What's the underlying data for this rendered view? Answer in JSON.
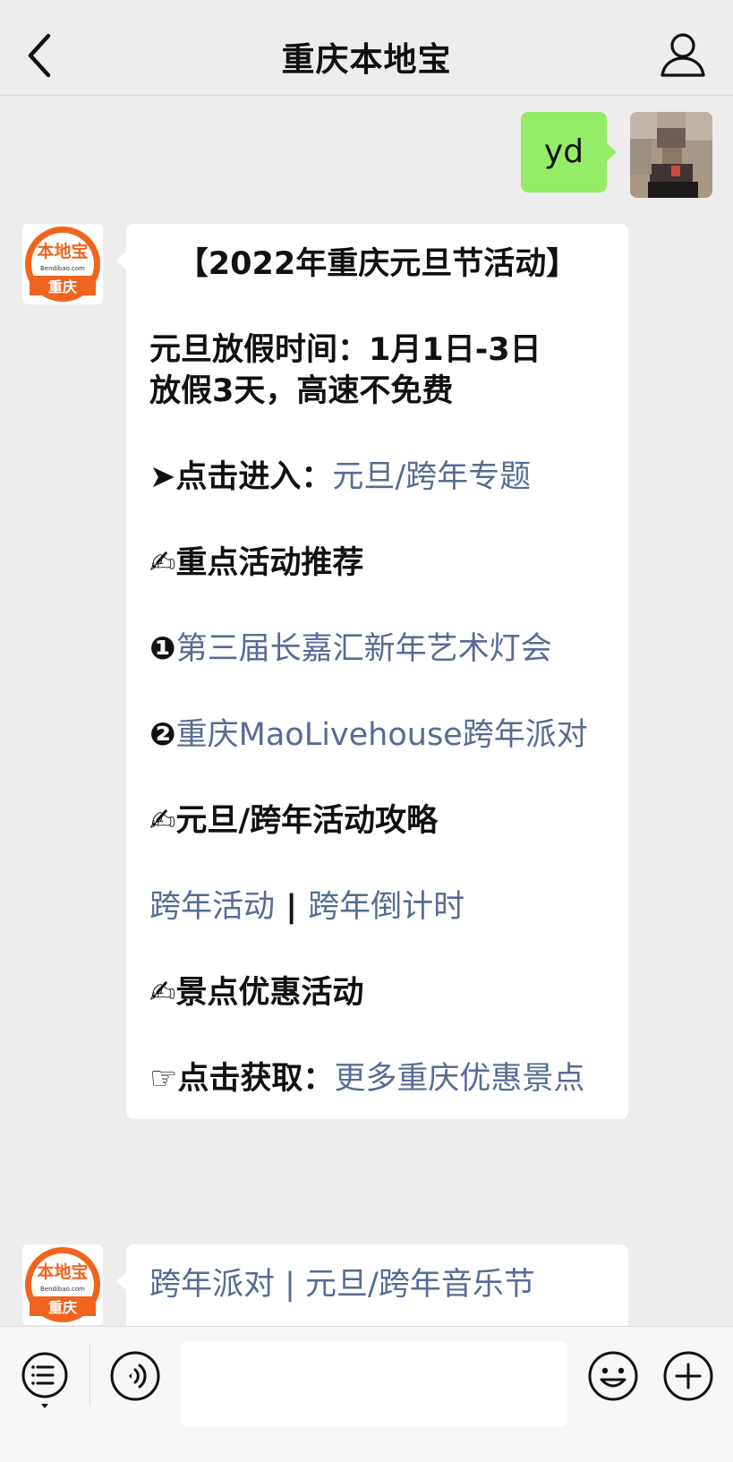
{
  "header": {
    "title": "重庆本地宝"
  },
  "outgoing_message": {
    "text": "yd"
  },
  "account_avatar": {
    "top_text": "本地宝",
    "domain_text": "Bendibao.com",
    "city_text": "重庆",
    "brand_color": "#f0641e"
  },
  "incoming_message": {
    "title": "【2022年重庆元旦节活动】",
    "holiday_line1": "元旦放假时间：1月1日-3日",
    "holiday_line2": "放假3天，高速不免费",
    "enter_prefix": "➤点击进入：",
    "enter_link": "元旦/跨年专题",
    "section1": "✍重点活动推荐",
    "item1_marker": "❶",
    "item1_link": "第三届长嘉汇新年艺术灯会",
    "item2_marker": "❷",
    "item2_link": "重庆MaoLivehouse跨年派对",
    "section2": "✍元旦/跨年活动攻略",
    "link_a": "跨年活动",
    "separator": " | ",
    "link_b": "跨年倒计时",
    "section3": "✍景点优惠活动",
    "get_prefix": "☞点击获取：",
    "get_link": "更多重庆优惠景点"
  },
  "second_message": {
    "partial_text": "跨年派对 | 元旦/跨年音乐节"
  },
  "colors": {
    "link": "#576b95",
    "outgoing_bubble": "#95ec69",
    "background": "#ededed"
  },
  "icons": {
    "back": "chevron-left-icon",
    "profile": "person-icon",
    "menu": "list-menu-icon",
    "voice": "voice-icon",
    "emoji": "smiley-icon",
    "more": "plus-icon"
  }
}
